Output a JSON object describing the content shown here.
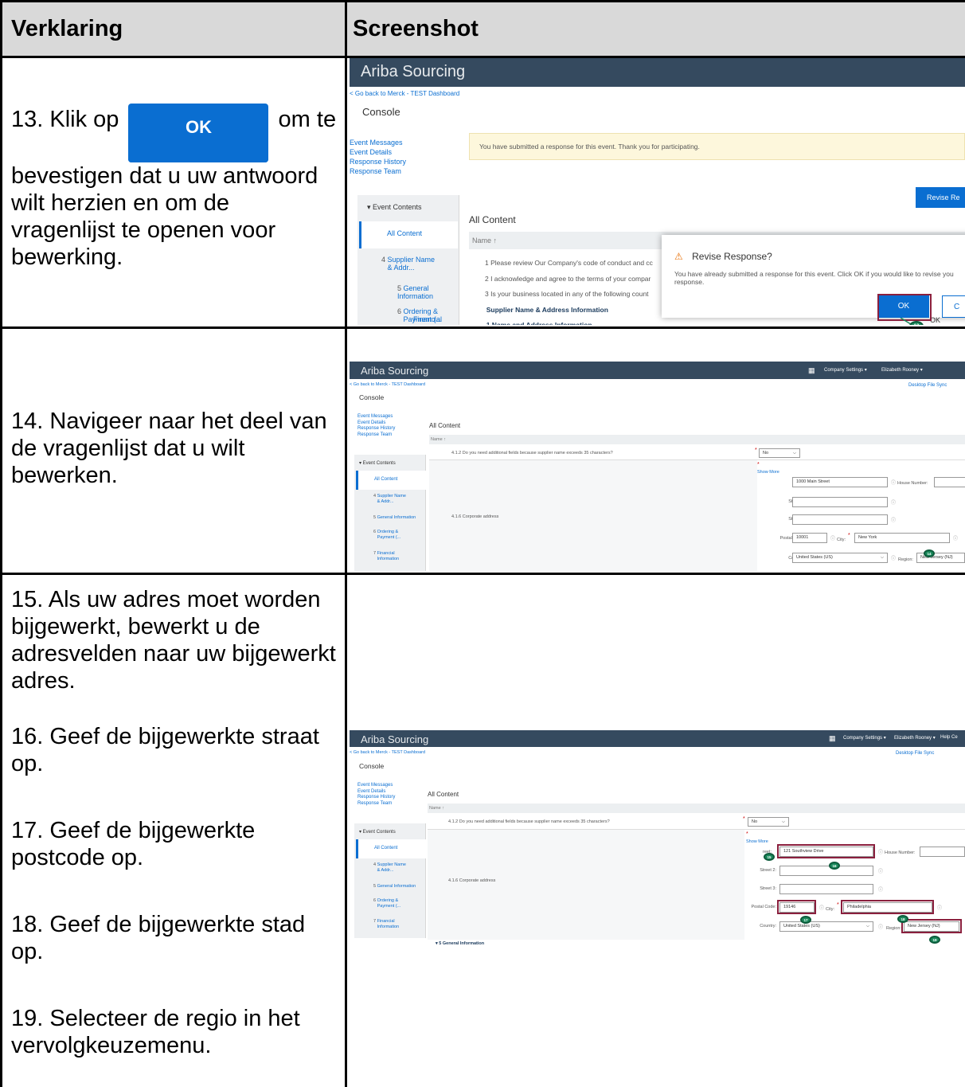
{
  "table": {
    "col1_header": "Verklaring",
    "col2_header": "Screenshot"
  },
  "step13": {
    "before": "13. Klik op",
    "button": "OK",
    "after": "om te bevestigen dat u uw antwoord wilt herzien en om de vragenlijst te openen voor bewerking."
  },
  "step14": "14. Navigeer naar het deel van de vragenlijst dat u wilt bewerken.",
  "step15": "15. Als uw adres moet worden bijgewerkt, bewerkt u de adresvelden naar uw bijgewerkt adres.",
  "step16": "16. Geef de bijgewerkte straat op.",
  "step17": "17. Geef de bijgewerkte postcode op.",
  "step18": "18. Geef de bijgewerkte stad op.",
  "step19": "19. Selecteer de regio in het vervolgkeuzemenu.",
  "shot1": {
    "brand": "Ariba Sourcing",
    "back_link": "< Go back to Merck - TEST Dashboard",
    "console": "Console",
    "nav": [
      "Event Messages",
      "Event Details",
      "Response History",
      "Response Team"
    ],
    "event_contents": "▾  Event Contents",
    "all_content_nav": "All Content",
    "sections": [
      {
        "num": "4",
        "label": "Supplier Name & Addr..."
      },
      {
        "num": "5",
        "label": "General Information"
      },
      {
        "num": "6",
        "label": "Ordering & Payment (..."
      },
      {
        "num": "7",
        "label": "Financial"
      }
    ],
    "banner": "You have submitted a response for this event. Thank you for participating.",
    "revise_button": "Revise Re",
    "all_content_title": "All Content",
    "name_col": "Name ↑",
    "rows": [
      "1  Please review Our Company's code of conduct and cc",
      "2  I acknowledge and agree to the terms of your compar",
      "3  Is your business located in any of the following count",
      "▾  4  Supplier Name & Address Information",
      "▾  4.1  Name and Address Information"
    ],
    "dialog_title": "Revise Response?",
    "dialog_text": "You have already submitted a response for this event. Click OK if you would like to revise you response.",
    "ok": "OK",
    "cancel": "C",
    "ok_small": "OK",
    "callout": "13"
  },
  "shot2": {
    "brand": "Ariba Sourcing",
    "company_settings": "Company Settings ▾",
    "user": "Elizabeth Rooney ▾",
    "back_link": "< Go back to Merck - TEST Dashboard",
    "desktop_sync": "Desktop File Sync",
    "console": "Console",
    "nav": [
      "Event Messages",
      "Event Details",
      "Response History",
      "Response Team"
    ],
    "event_contents": "▾  Event Contents",
    "all_content_nav": "All Content",
    "sections": [
      {
        "num": "4",
        "label": "Supplier Name & Addr..."
      },
      {
        "num": "5",
        "label": "General Information"
      },
      {
        "num": "6",
        "label": "Ordering & Payment (..."
      },
      {
        "num": "7",
        "label": "Financial Information"
      }
    ],
    "all_content_title": "All Content",
    "name_col": "Name ↑",
    "q412": "4.1.2  Do you need additional fields because supplier name exceeds 35 characters?",
    "q412_value": "No",
    "q416": "4.1.6  Corporate address",
    "show_more": "Show More",
    "street_label": "Street:",
    "street_value": "1000 Main Street",
    "house_label": "House Number:",
    "street2_label": "Street 2:",
    "street3_label": "Street 3:",
    "postal_label": "Postal Code:",
    "postal_value": "10001",
    "city_label": "City:",
    "city_value": "New York",
    "country_label": "Country:",
    "country_value": "United States (US)",
    "region_label": "Region:",
    "region_value": "New Jersey (NJ)",
    "callout": "14"
  },
  "shot3": {
    "brand": "Ariba Sourcing",
    "company_settings": "Company Settings ▾",
    "user": "Elizabeth Rooney ▾",
    "help": "Help Ce",
    "back_link": "< Go back to Merck - TEST Dashboard",
    "desktop_sync": "Desktop File Sync",
    "console": "Console",
    "nav": [
      "Event Messages",
      "Event Details",
      "Response History",
      "Response Team"
    ],
    "event_contents": "▾  Event Contents",
    "all_content_nav": "All Content",
    "sections": [
      {
        "num": "4",
        "label": "Supplier Name & Addr..."
      },
      {
        "num": "5",
        "label": "General Information"
      },
      {
        "num": "6",
        "label": "Ordering & Payment (..."
      },
      {
        "num": "7",
        "label": "Financial Information"
      }
    ],
    "all_content_title": "All Content",
    "name_col": "Name ↑",
    "q412": "4.1.2  Do you need additional fields because supplier name exceeds 35 characters?",
    "q412_value": "No",
    "q416": "4.1.6  Corporate address",
    "show_more": "Show More",
    "street_label": "reet:",
    "street_value": "121 Southview Drive",
    "house_label": "House Number:",
    "street2_label": "Street 2:",
    "street3_label": "Street 3:",
    "postal_label": "Postal Code:",
    "postal_value": "19146",
    "city_label": "City:",
    "city_value": "Philadelphia",
    "country_label": "Country:",
    "country_value": "United States (US)",
    "region_label": "Region:",
    "region_value": "New Jersey (NJ)",
    "general_info": "▾  5  General Information",
    "callouts": [
      "15",
      "16",
      "17",
      "18",
      "19"
    ]
  },
  "colors": {
    "header_bg": "#354a5f",
    "accent": "#0a6ed1",
    "callout": "#1a8a5c",
    "highlight": "#8a1f3d",
    "table_header": "#d9d9d9"
  }
}
